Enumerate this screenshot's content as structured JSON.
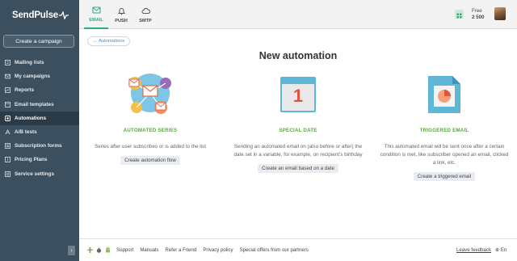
{
  "brand": {
    "name": "SendPulse"
  },
  "sidebar": {
    "create_label": "Create a campaign",
    "items": [
      {
        "label": "Mailing lists",
        "icon": "list-icon"
      },
      {
        "label": "My campaigns",
        "icon": "envelope-icon"
      },
      {
        "label": "Reports",
        "icon": "reports-icon"
      },
      {
        "label": "Email templates",
        "icon": "template-icon"
      },
      {
        "label": "Automations",
        "icon": "automation-icon",
        "active": true
      },
      {
        "label": "A/B tests",
        "icon": "ab-test-icon"
      },
      {
        "label": "Subscription forms",
        "icon": "form-icon"
      },
      {
        "label": "Pricing Plans",
        "icon": "pricing-icon"
      },
      {
        "label": "Service settings",
        "icon": "settings-icon"
      }
    ],
    "collapse_glyph": "‹"
  },
  "topbar": {
    "tabs": [
      {
        "label": "EMAIL",
        "icon": "email-icon",
        "active": true
      },
      {
        "label": "PUSH",
        "icon": "bell-icon"
      },
      {
        "label": "SMTP",
        "icon": "cloud-icon"
      }
    ],
    "plan_name": "Free",
    "plan_value": "2 500"
  },
  "main": {
    "breadcrumb": "← Automations",
    "title": "New automation",
    "columns": [
      {
        "title": "AUTOMATED SERIES",
        "description": "Series after user subscribes or is added to the list",
        "button": "Create automation flow",
        "illustration": "automated-series-illustration"
      },
      {
        "title": "SPECIAL DATE",
        "description": "Sending an automated email on (also before or after) the date set in a variable, for example, on recipient's birthday",
        "button": "Create an email based on a date",
        "illustration": "calendar-illustration",
        "calendar_day": "1"
      },
      {
        "title": "TRIGGERED EMAIL",
        "description": "This automated email will be sent once after a certain condition is met, like subscriber opened an email, clicked a link, etc.",
        "button": "Create a triggered email",
        "illustration": "document-chart-illustration"
      }
    ]
  },
  "footer": {
    "links": [
      "Support",
      "Manuals",
      "Refer a Friend",
      "Privacy policy",
      "Special offers from our partners"
    ],
    "feedback": "Leave feedback",
    "language": "En"
  },
  "colors": {
    "sidebar_bg": "#3b4f5e",
    "accent_green": "#2eab7a",
    "column_title_green": "#59a83f",
    "link_blue": "#4a8bc9"
  }
}
